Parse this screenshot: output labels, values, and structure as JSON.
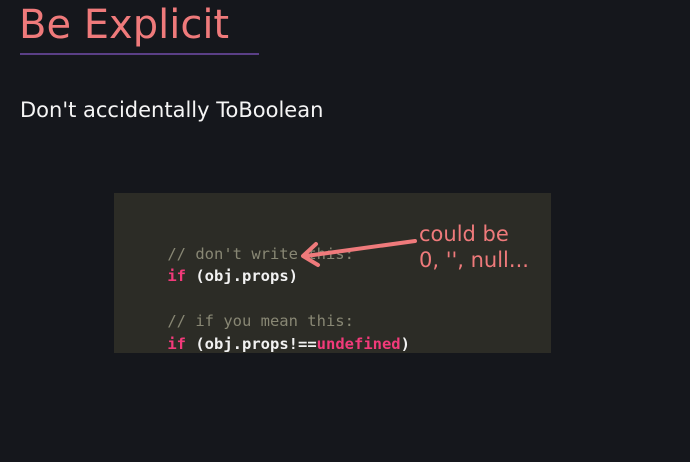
{
  "slide": {
    "title": "Be Explicit",
    "subtitle": "Don't accidentally ToBoolean"
  },
  "code": {
    "line1_comment": "// don't write this:",
    "line2_keyword": "if",
    "line2_rest": " (obj.props)",
    "line3_comment": "// if you mean this:",
    "line4_keyword": "if",
    "line4_rest": " (obj.props!==",
    "line4_undefined": "undefined",
    "line4_close": ")"
  },
  "annotation": {
    "line1": "could be",
    "line2": "0, '', null..."
  },
  "colors": {
    "background": "#15171c",
    "title": "#ef7a7b",
    "underline": "#5a3f86",
    "code_background": "#2c2c26",
    "comment": "#888774",
    "keyword": "#f23a7a",
    "arrow": "#ef7a7b"
  },
  "icons": {
    "arrow": "left-arrow-icon"
  }
}
